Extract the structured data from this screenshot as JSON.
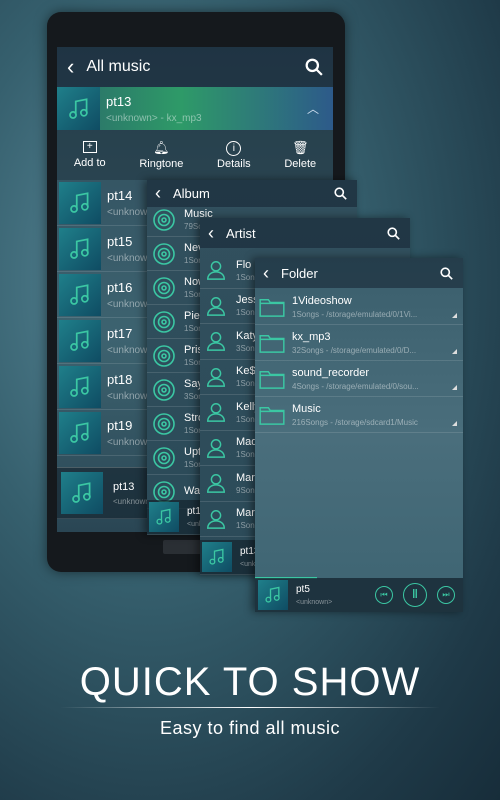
{
  "main": {
    "title": "All music",
    "selected": {
      "title": "pt13",
      "subtitle": "<unknown> - kx_mp3"
    },
    "actions": [
      {
        "label": "Add to",
        "icon": "add-box-icon"
      },
      {
        "label": "Ringtone",
        "icon": "bell-icon"
      },
      {
        "label": "Details",
        "icon": "info-icon"
      },
      {
        "label": "Delete",
        "icon": "trash-icon"
      }
    ],
    "songs": [
      {
        "title": "pt14",
        "subtitle": "<unknown>"
      },
      {
        "title": "pt15",
        "subtitle": "<unknown>"
      },
      {
        "title": "pt16",
        "subtitle": "<unknown>"
      },
      {
        "title": "pt17",
        "subtitle": "<unknown>"
      },
      {
        "title": "pt18",
        "subtitle": "<unknown>"
      },
      {
        "title": "pt19",
        "subtitle": "<unknown>"
      }
    ],
    "player": {
      "title": "pt13",
      "subtitle": "<unknown>"
    }
  },
  "album": {
    "title": "Album",
    "items": [
      {
        "name": "Music",
        "count": "79Songs"
      },
      {
        "name": "Nev",
        "count": "1Songs"
      },
      {
        "name": "Now",
        "count": "1Songs"
      },
      {
        "name": "Piec",
        "count": "1Songs"
      },
      {
        "name": "Pris",
        "count": "1Songs"
      },
      {
        "name": "Say",
        "count": "3Songs"
      },
      {
        "name": "Stro",
        "count": "1Songs"
      },
      {
        "name": "Upto",
        "count": "1Songs"
      },
      {
        "name": "War",
        "count": ""
      }
    ],
    "player": {
      "title": "pt13",
      "subtitle": "<unknown>"
    }
  },
  "artist": {
    "title": "Artist",
    "items": [
      {
        "name": "Flo R",
        "count": "1Songs"
      },
      {
        "name": "Jess",
        "count": "1Songs"
      },
      {
        "name": "Katy",
        "count": "3Songs"
      },
      {
        "name": "Ke$",
        "count": "1Songs"
      },
      {
        "name": "Kelly",
        "count": "1Songs"
      },
      {
        "name": "Mad",
        "count": "1Songs"
      },
      {
        "name": "Mar",
        "count": "9Songs"
      },
      {
        "name": "Mar",
        "count": "1Songs"
      }
    ],
    "player": {
      "title": "pt13",
      "subtitle": "<unknown>"
    }
  },
  "folder": {
    "title": "Folder",
    "items": [
      {
        "name": "1Videoshow",
        "info": "1Songs  -  /storage/emulated/0/1Vi..."
      },
      {
        "name": "kx_mp3",
        "info": "32Songs  -  /storage/emulated/0/D..."
      },
      {
        "name": "sound_recorder",
        "info": "4Songs  -  /storage/emulated/0/sou..."
      },
      {
        "name": "Music",
        "info": "216Songs  -  /storage/sdcard1/Music"
      }
    ],
    "player": {
      "title": "pt5",
      "subtitle": "<unknown>",
      "progress": 0.3
    }
  },
  "promo": {
    "headline": "QUICK TO SHOW",
    "tagline": "Easy to find all music"
  },
  "colors": {
    "accent": "#3bc7a3"
  }
}
